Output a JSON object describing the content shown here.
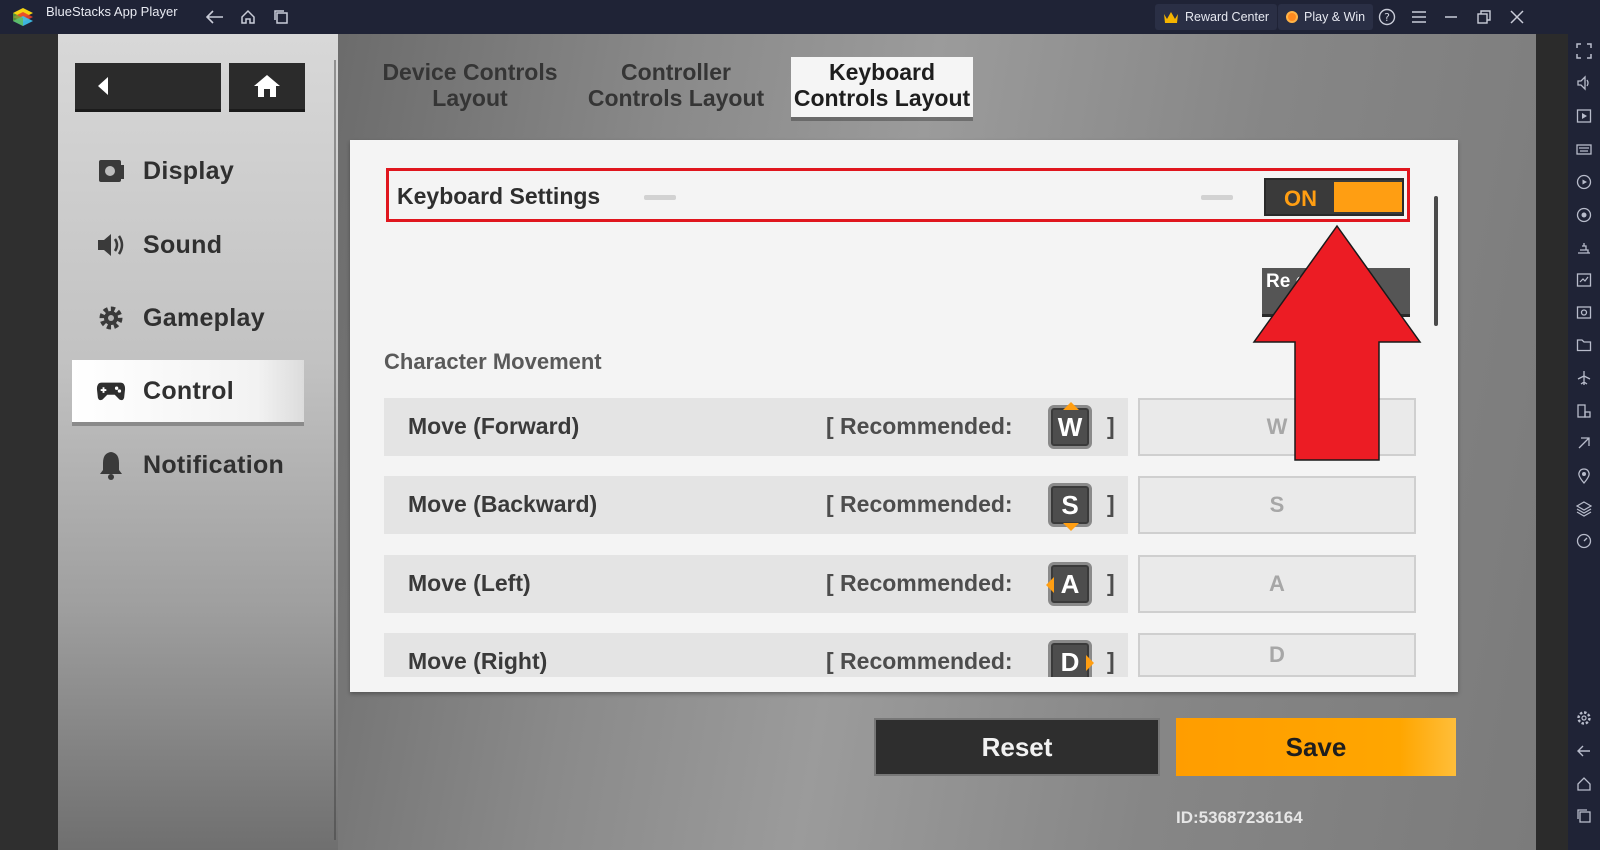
{
  "titlebar": {
    "app_title": "BlueStacks App Player",
    "reward_center": "Reward Center",
    "play_win": "Play & Win"
  },
  "game": {
    "menu": [
      {
        "label": "Display",
        "icon": "display-icon"
      },
      {
        "label": "Sound",
        "icon": "sound-icon"
      },
      {
        "label": "Gameplay",
        "icon": "gear-icon"
      },
      {
        "label": "Control",
        "icon": "gamepad-icon"
      },
      {
        "label": "Notification",
        "icon": "bell-icon"
      }
    ],
    "active_menu": "Control",
    "tabs": [
      {
        "line1": "Device Controls",
        "line2": "Layout"
      },
      {
        "line1": "Controller",
        "line2": "Controls Layout"
      },
      {
        "line1": "Keyboard",
        "line2": "Controls Layout"
      }
    ],
    "active_tab": "Keyboard Controls Layout",
    "keyboard_settings": {
      "label": "Keyboard Settings",
      "toggle_text": "ON",
      "toggle_state": "on"
    },
    "recommended_controls_button": "Recommended Controls",
    "recommended_controls_visible": "Re          ols",
    "section_title": "Character Movement",
    "actions": [
      {
        "label": "Move (Forward)",
        "recommended_text": "[ Recommended:",
        "recommended_key": "W",
        "bracket": "]",
        "assigned_key": "W"
      },
      {
        "label": "Move (Backward)",
        "recommended_text": "[ Recommended:",
        "recommended_key": "S",
        "bracket": "]",
        "assigned_key": "S"
      },
      {
        "label": "Move (Left)",
        "recommended_text": "[ Recommended:",
        "recommended_key": "A",
        "bracket": "]",
        "assigned_key": "A"
      },
      {
        "label": "Move (Right)",
        "recommended_text": "[ Recommended:",
        "recommended_key": "D",
        "bracket": "]",
        "assigned_key": "D"
      }
    ],
    "reset_button": "Reset",
    "save_button": "Save",
    "id_text": "ID:53687236164"
  },
  "colors": {
    "accent_orange": "#ff9e12",
    "highlight_red": "#e0161e",
    "titlebar_bg": "#1f2336"
  }
}
